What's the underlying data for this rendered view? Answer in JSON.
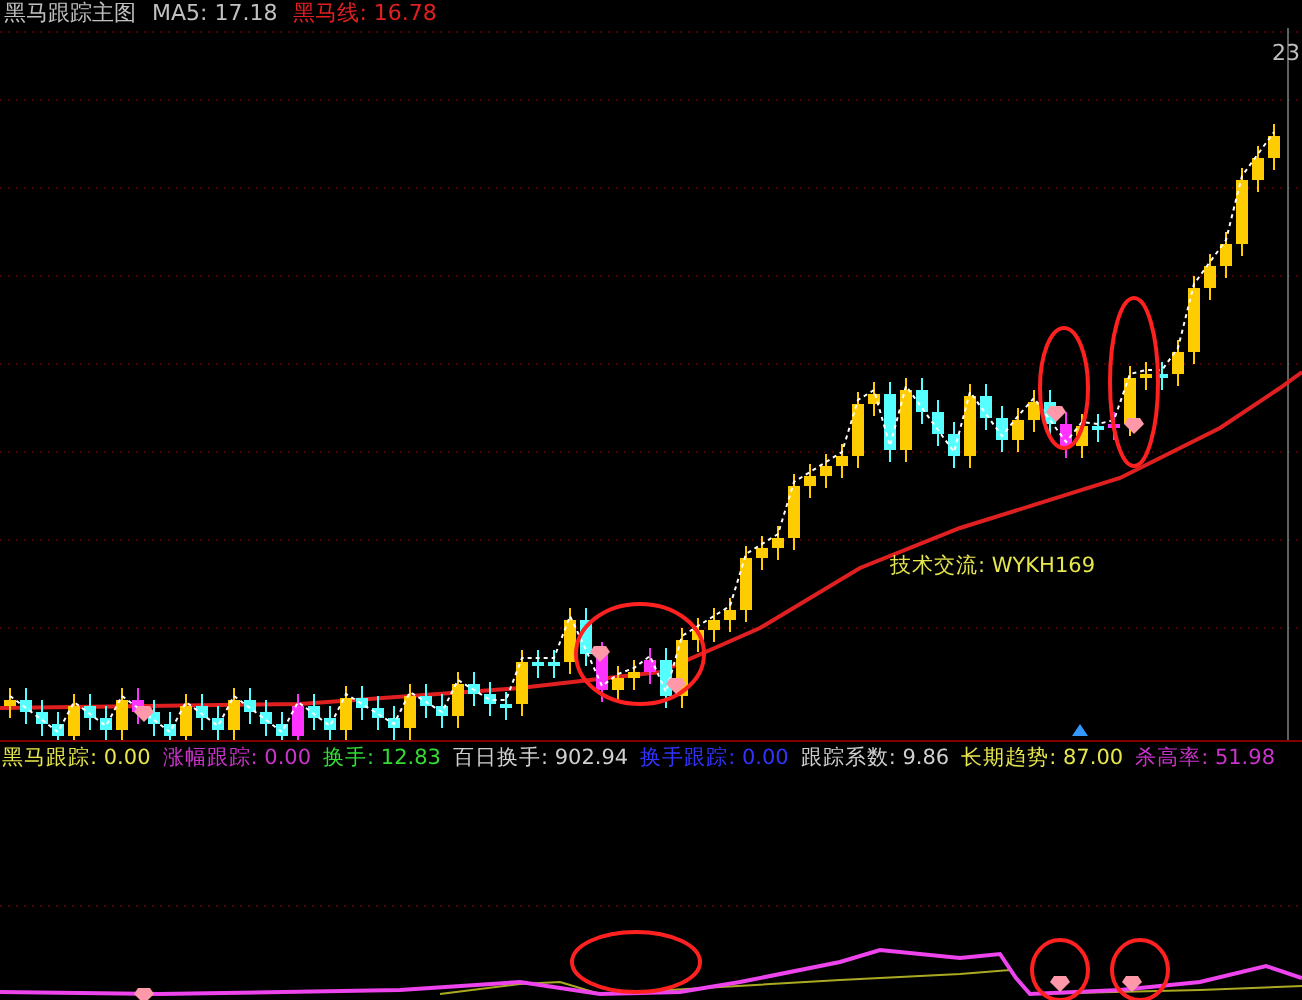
{
  "header": [
    {
      "text": "黑马跟踪主图",
      "color": "#c0c0c0"
    },
    {
      "text": "MA5: 17.18",
      "color": "#c0c0c0"
    },
    {
      "text": "黑马线: 16.78",
      "color": "#e02020"
    }
  ],
  "chart": {
    "peak_label": "23",
    "annotation": "技术交流: WYKH169"
  },
  "readouts": [
    {
      "text": "黑马跟踪: 0.00",
      "color": "#e6e64d"
    },
    {
      "text": "涨幅跟踪: 0.00",
      "color": "#cc33cc"
    },
    {
      "text": "换手: 12.83",
      "color": "#33dd33"
    },
    {
      "text": "百日换手: 902.94",
      "color": "#d0d0d0"
    },
    {
      "text": "换手跟踪: 0.00",
      "color": "#3333ff"
    },
    {
      "text": "跟踪系数: 9.86",
      "color": "#d0d0d0"
    },
    {
      "text": "长期趋势: 87.00",
      "color": "#e6e64d"
    },
    {
      "text": "杀高率: 51.98",
      "color": "#cc33cc"
    }
  ]
}
